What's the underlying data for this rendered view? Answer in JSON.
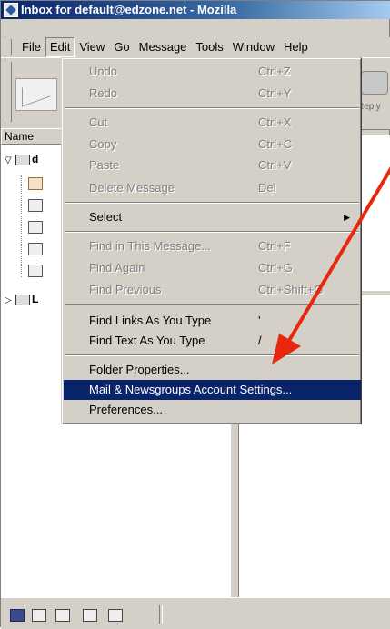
{
  "window": {
    "title": "Inbox for default@edzone.net - Mozilla"
  },
  "menubar": {
    "items": [
      {
        "label": "File"
      },
      {
        "label": "Edit"
      },
      {
        "label": "View"
      },
      {
        "label": "Go"
      },
      {
        "label": "Message"
      },
      {
        "label": "Tools"
      },
      {
        "label": "Window"
      },
      {
        "label": "Help"
      }
    ]
  },
  "toolbar": {
    "reply_label": "Reply"
  },
  "folder_pane": {
    "header": "Name",
    "accounts": [
      {
        "label": "d",
        "expanded": true
      },
      {
        "label": "L",
        "expanded": false
      }
    ]
  },
  "edit_menu": {
    "items": [
      {
        "label": "Undo",
        "accel": "Ctrl+Z",
        "enabled": false
      },
      {
        "label": "Redo",
        "accel": "Ctrl+Y",
        "enabled": false
      },
      {
        "label": "Cut",
        "accel": "Ctrl+X",
        "enabled": false
      },
      {
        "label": "Copy",
        "accel": "Ctrl+C",
        "enabled": false
      },
      {
        "label": "Paste",
        "accel": "Ctrl+V",
        "enabled": false
      },
      {
        "label": "Delete Message",
        "accel": "Del",
        "enabled": false
      },
      {
        "label": "Select",
        "accel": "",
        "enabled": true,
        "submenu": true
      },
      {
        "label": "Find in This Message...",
        "accel": "Ctrl+F",
        "enabled": false
      },
      {
        "label": "Find Again",
        "accel": "Ctrl+G",
        "enabled": false
      },
      {
        "label": "Find Previous",
        "accel": "Ctrl+Shift+G",
        "enabled": false
      },
      {
        "label": "Find Links As You Type",
        "accel": "'",
        "enabled": true
      },
      {
        "label": "Find Text As You Type",
        "accel": "/",
        "enabled": true
      },
      {
        "label": "Folder Properties...",
        "accel": "",
        "enabled": true
      },
      {
        "label": "Mail & Newsgroups Account Settings...",
        "accel": "",
        "enabled": true,
        "highlighted": true
      },
      {
        "label": "Preferences...",
        "accel": "",
        "enabled": true
      }
    ]
  },
  "colors": {
    "highlight": "#0a246a",
    "annotation_arrow": "#e8280e"
  },
  "statusbar": {
    "icons": [
      "navigator-icon",
      "mail-icon",
      "composer-icon",
      "address-book-icon",
      "chatzilla-icon"
    ]
  }
}
